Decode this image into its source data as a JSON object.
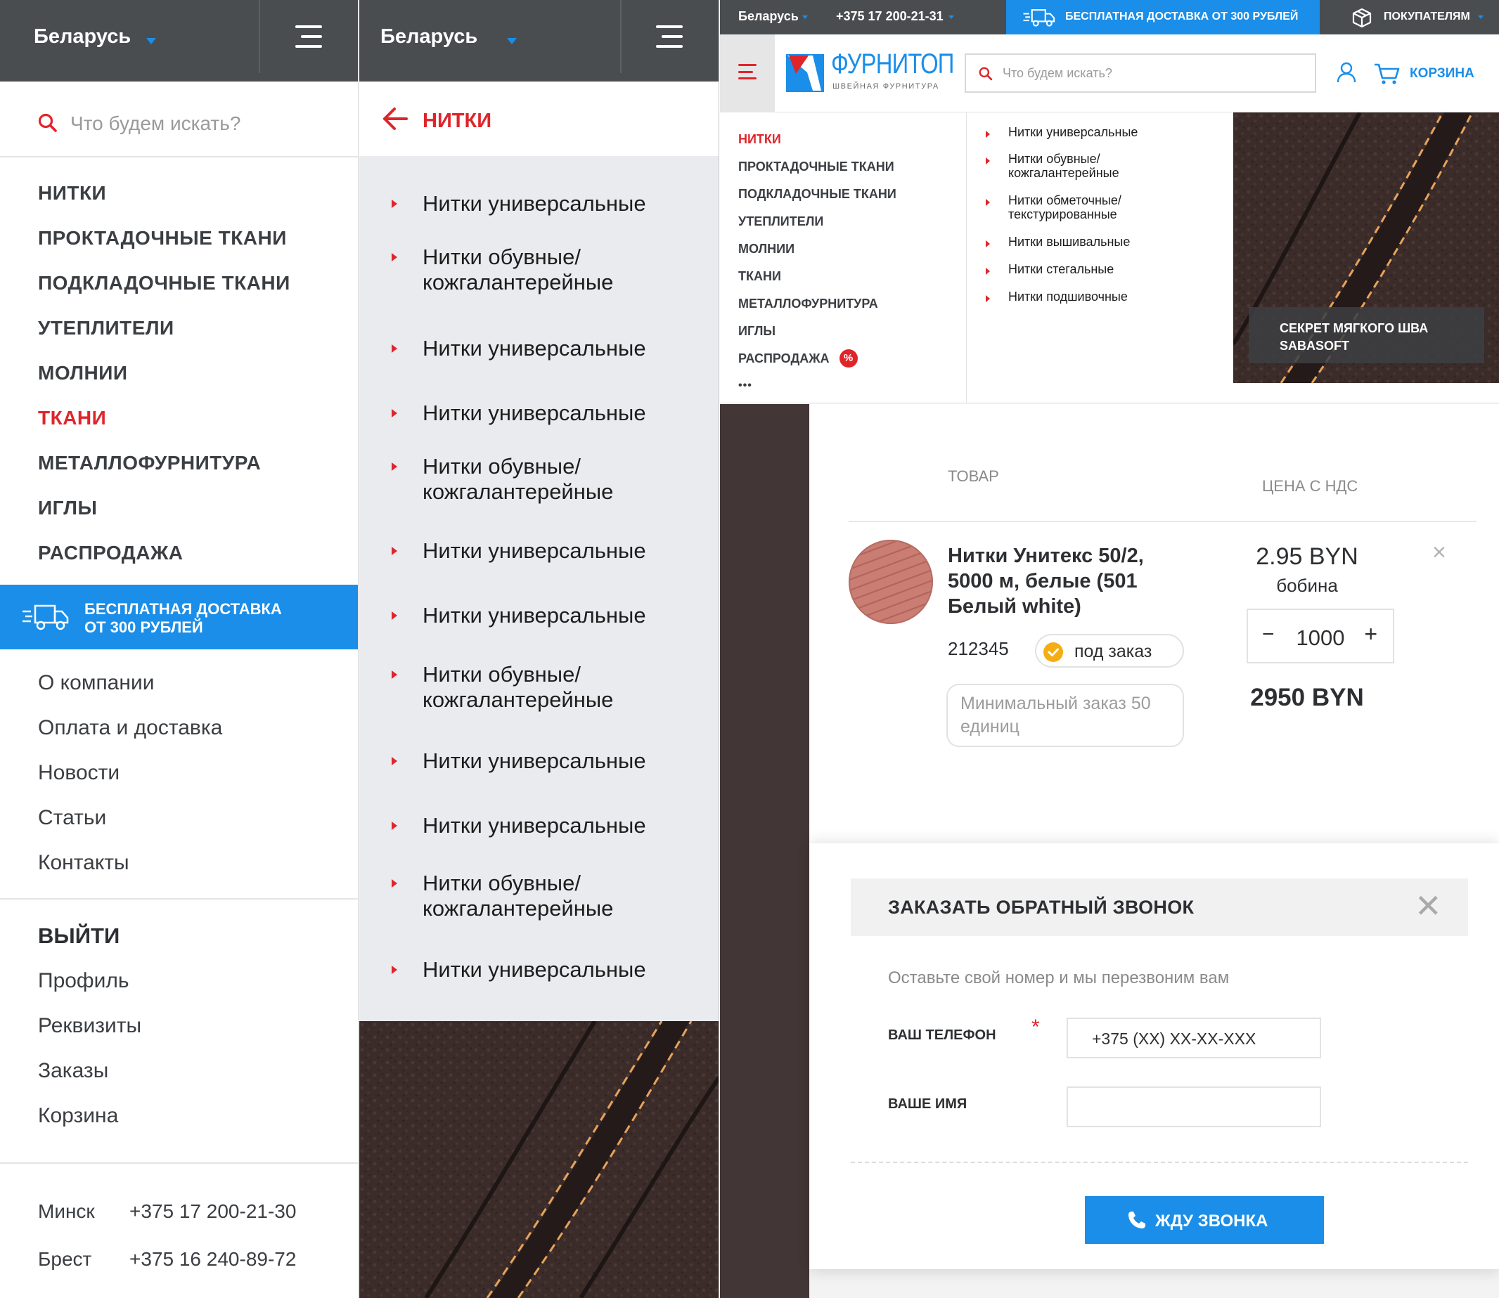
{
  "colors": {
    "accent_blue": "#1a8ee8",
    "accent_red": "#e0252a",
    "header_gray": "#4a4d50",
    "submenu_bg": "#e9ebee"
  },
  "mobile_menu": {
    "region": "Беларусь",
    "search_placeholder": "Что будем искать?",
    "categories": [
      "НИТКИ",
      "ПРОКТАДОЧНЫЕ ТКАНИ",
      "ПОДКЛАДОЧНЫЕ ТКАНИ",
      "УТЕПЛИТЕЛИ",
      "МОЛНИИ",
      "ТКАНИ",
      "МЕТАЛЛОФУРНИТУРА",
      "ИГЛЫ",
      "РАСПРОДАЖА"
    ],
    "active_category": "ТКАНИ",
    "delivery_line1": "БЕСПЛАТНАЯ ДОСТАВКА",
    "delivery_line2": "ОТ 300 РУБЛЕЙ",
    "info_links": [
      "О компании",
      "Оплата и доставка",
      "Новости",
      "Статьи",
      "Контакты"
    ],
    "logout": "ВЫЙТИ",
    "account_links": [
      "Профиль",
      "Реквизиты",
      "Заказы",
      "Корзина"
    ],
    "phones": [
      {
        "city": "Минск",
        "number": "+375 17 200-21-30"
      },
      {
        "city": "Брест",
        "number": "+375 16 240-89-72"
      }
    ]
  },
  "mobile_submenu": {
    "region": "Беларусь",
    "back_title": "НИТКИ",
    "items": [
      "Нитки универсальные",
      "Нитки обувные/\nкожгалантерейные",
      "Нитки универсальные",
      "Нитки универсальные",
      "Нитки обувные/\nкожгалантерейные",
      "Нитки универсальные",
      "Нитки универсальные",
      "Нитки обувные/\nкожгалантерейные",
      "Нитки универсальные",
      "Нитки универсальные",
      "Нитки обувные/\nкожгалантерейные",
      "Нитки универсальные"
    ]
  },
  "desktop": {
    "topbar": {
      "region": "Беларусь",
      "phone": "+375 17 200-21-31",
      "free_delivery": "БЕСПЛАТНАЯ ДОСТАВКА ОТ 300 РУБЛЕЙ",
      "buyers": "ПОКУПАТЕЛЯМ"
    },
    "logo": {
      "name": "ФУРНИТОП",
      "tagline": "ШВЕЙНАЯ ФУРНИТУРА"
    },
    "search_placeholder": "Что будем искать?",
    "cart_label": "КОРЗИНА",
    "mega_categories": [
      "НИТКИ",
      "ПРОКТАДОЧНЫЕ ТКАНИ",
      "ПОДКЛАДОЧНЫЕ ТКАНИ",
      "УТЕПЛИТЕЛИ",
      "МОЛНИИ",
      "ТКАНИ",
      "МЕТАЛЛОФУРНИТУРА",
      "ИГЛЫ",
      "РАСПРОДАЖА"
    ],
    "mega_active": "НИТКИ",
    "sale_badge": "%",
    "more": "•••",
    "mega_subcategories": [
      "Нитки универсальные",
      "Нитки обувные/\nкожгалантерейные",
      "Нитки обметочные/\nтекстурированные",
      "Нитки вышивальные",
      "Нитки стегальные",
      "Нитки подшивочные"
    ],
    "promo_line1": "СЕКРЕТ МЯГКОГО ШВА",
    "promo_line2": "SABASOFT",
    "cart": {
      "col_product": "ТОВАР",
      "col_price": "ЦЕНА С НДС",
      "product_name": "Нитки Унитекс 50/2, 5000 м, белые (501 Белый white)",
      "sku": "212345",
      "availability": "под заказ",
      "min_order": "Минимальный заказ 50 единиц",
      "price": "2.95 BYN",
      "unit": "бобина",
      "qty_minus": "−",
      "quantity": "1000",
      "qty_plus": "+",
      "total": "2950 BYN",
      "remove": "×"
    },
    "callback": {
      "title": "ЗАКАЗАТЬ ОБРАТНЫЙ ЗВОНОК",
      "close": "✕",
      "hint": "Оставьте свой номер и мы перезвоним вам",
      "phone_label": "ВАШ ТЕЛЕФОН",
      "required_mark": "*",
      "phone_placeholder": "+375 (XX) XX-XX-XXX",
      "name_label": "ВАШЕ ИМЯ",
      "name_placeholder": "",
      "submit": "ЖДУ ЗВОНКА"
    }
  }
}
